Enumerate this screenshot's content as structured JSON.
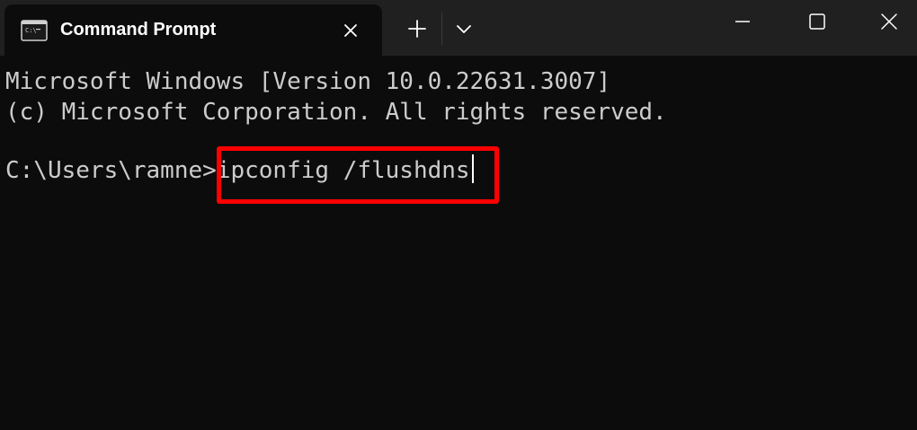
{
  "window": {
    "tab_title": "Command Prompt",
    "tab_icon": "console-icon",
    "controls": {
      "new_tab_icon": "plus-icon",
      "dropdown_icon": "chevron-down-icon",
      "minimize_icon": "minimize-icon",
      "maximize_icon": "maximize-icon",
      "close_icon": "close-icon"
    }
  },
  "console": {
    "lines": [
      "Microsoft Windows [Version 10.0.22631.3007]",
      "(c) Microsoft Corporation. All rights reserved."
    ],
    "prompt": "C:\\Users\\ramne>",
    "command": "ipconfig /flushdns"
  },
  "colors": {
    "background": "#0c0c0c",
    "titlebar": "#202020",
    "text": "#cccccc",
    "highlight": "#ff0000"
  }
}
